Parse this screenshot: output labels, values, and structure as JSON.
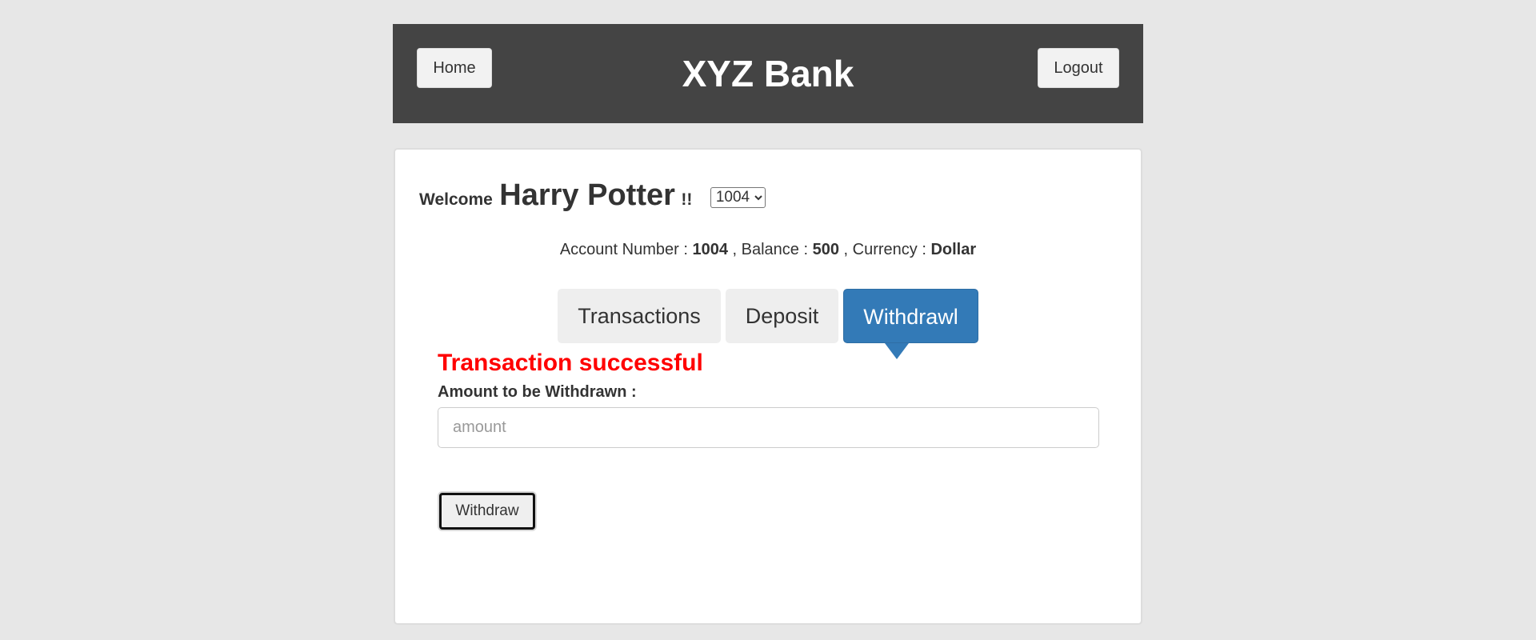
{
  "header": {
    "home_label": "Home",
    "title": "XYZ Bank",
    "logout_label": "Logout",
    "background_color": "#444444"
  },
  "welcome": {
    "prefix": "Welcome",
    "customer_name": "Harry Potter",
    "suffix": "!!",
    "selected_account": "1004",
    "account_options": [
      "1004"
    ]
  },
  "account_info": {
    "account_number_label": "Account Number :",
    "account_number": "1004",
    "balance_label": ", Balance :",
    "balance": "500",
    "currency_label": ", Currency :",
    "currency": "Dollar"
  },
  "tabs": [
    {
      "label": "Transactions",
      "active": false
    },
    {
      "label": "Deposit",
      "active": false
    },
    {
      "label": "Withdrawl",
      "active": true
    }
  ],
  "withdraw_form": {
    "message": "Transaction successful",
    "message_color": "#ff0000",
    "amount_label": "Amount to be Withdrawn :",
    "amount_placeholder": "amount",
    "amount_value": "",
    "submit_label": "Withdraw"
  },
  "colors": {
    "page_background": "#e7e7e7",
    "active_tab": "#337ab7"
  }
}
